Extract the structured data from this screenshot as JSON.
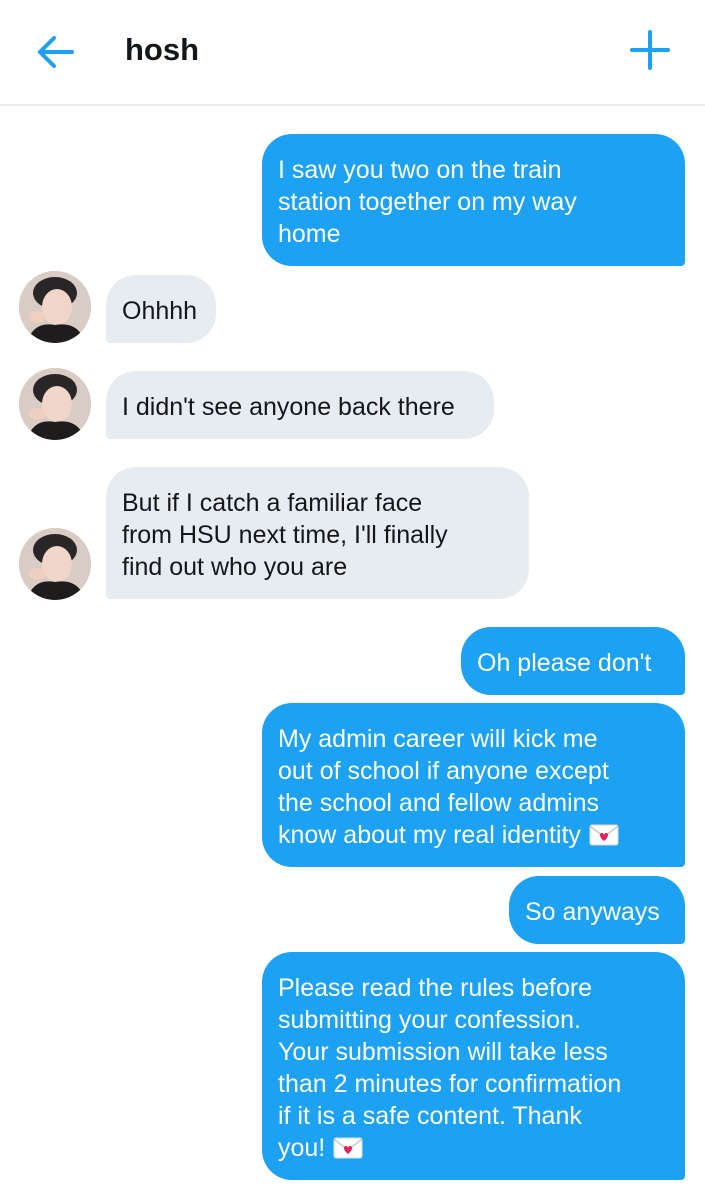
{
  "header": {
    "title": "hosh"
  },
  "messages": [
    {
      "text": "I saw you two on the train\nstation together on my way\nhome"
    },
    {
      "text": "Ohhhh"
    },
    {
      "text": "I didn't see anyone back there"
    },
    {
      "text": "But if I catch a familiar face\nfrom HSU next time, I'll finally\nfind out who you are"
    },
    {
      "text": "Oh please don't"
    },
    {
      "text": "My admin career will kick me\nout of school if anyone except\nthe school and fellow admins\nknow about my real identity"
    },
    {
      "text": "So anyways"
    },
    {
      "text": "Please read the rules before\nsubmitting your confession.\nYour submission will take less\nthan 2 minutes for confirmation\nif it is a safe content. Thank\nyou!"
    }
  ],
  "icons": {
    "back": "arrow-left-icon",
    "new": "plus-icon",
    "emoji": "love-letter-icon"
  },
  "colors": {
    "accent": "#1da1f2",
    "received_bubble": "#e6ecf0",
    "text_dark": "#14171a"
  }
}
